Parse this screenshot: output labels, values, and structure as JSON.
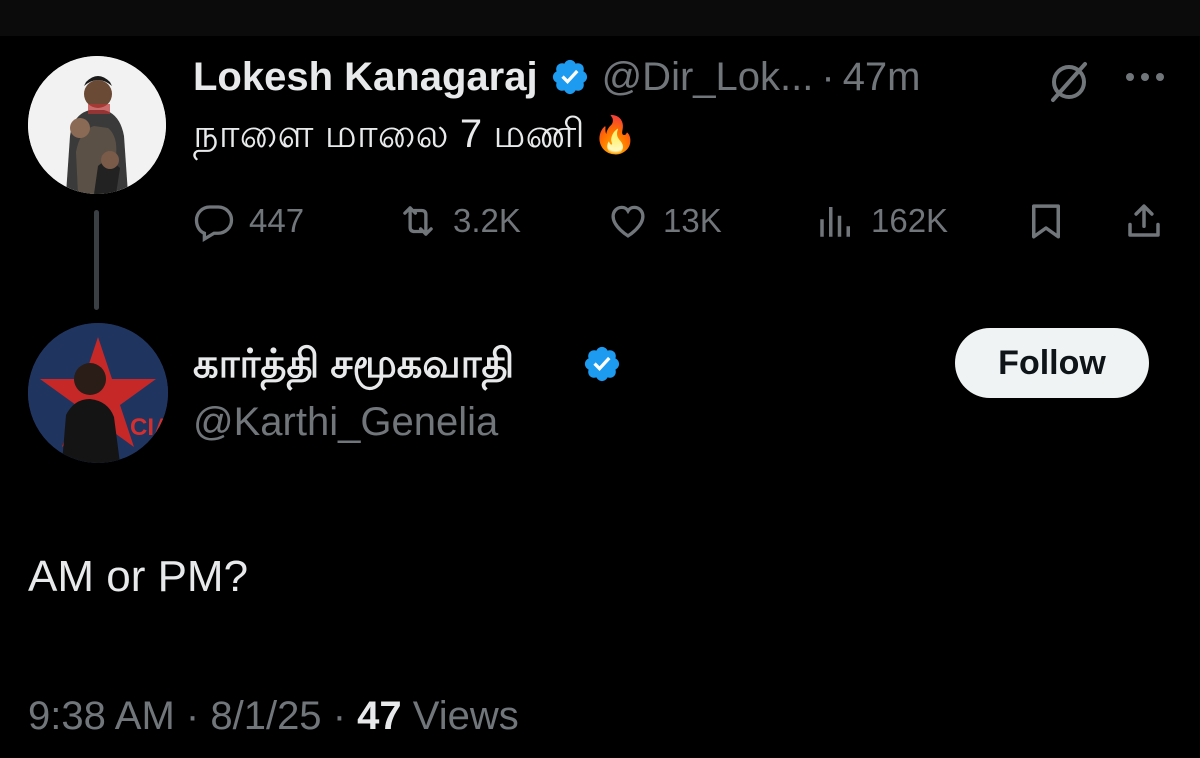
{
  "tweet": {
    "author_name": "Lokesh Kanagaraj",
    "handle": "@Dir_Lok...",
    "separator": "·",
    "time": "47m",
    "text": "நாளை மாலை 7 மணி",
    "emoji": "🔥",
    "stats": {
      "replies": "447",
      "reposts": "3.2K",
      "likes": "13K",
      "views": "162K"
    },
    "icons": [
      "grok-icon",
      "more-icon",
      "reply-icon",
      "repost-icon",
      "like-icon",
      "views-icon",
      "bookmark-icon",
      "share-icon"
    ]
  },
  "reply": {
    "author_name": "கார்த்தி சமூகவாதி",
    "handle": "@Karthi_Genelia",
    "follow_label": "Follow",
    "text": "AM or PM?",
    "time": "9:38 AM",
    "separator": "·",
    "date": "8/1/25",
    "views_count": "47",
    "views_label": "Views",
    "avatar_text": "CIA"
  },
  "colors": {
    "background": "#000000",
    "text": "#e7e9ea",
    "muted": "#71767b",
    "verified": "#1d9bf0",
    "follow_bg": "#eff3f4"
  }
}
